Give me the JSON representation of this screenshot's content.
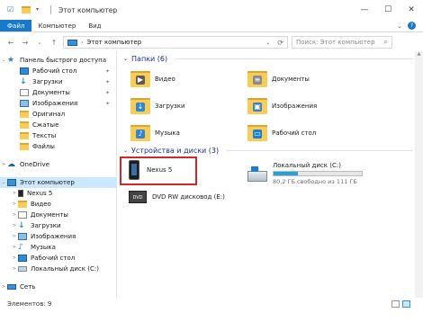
{
  "window": {
    "title": "Этот компьютер",
    "controls": {
      "minimize": "—",
      "maximize": "☐",
      "close": "✕"
    }
  },
  "ribbon": {
    "file_tab": "Файл",
    "tabs": [
      "Компьютер",
      "Вид"
    ],
    "expand": "⌄",
    "help": "?"
  },
  "address": {
    "back": "←",
    "forward": "→",
    "up": "↑",
    "history": "⌄",
    "path": "Этот компьютер",
    "refresh": "⟳",
    "search_placeholder": "Поиск: Этот компьютер",
    "search_icon": "search-icon"
  },
  "navpane": {
    "items": [
      {
        "label": "Панель быстрого доступа",
        "icon": "star-icon",
        "expand": "⌄"
      },
      {
        "label": "Рабочий стол",
        "icon": "desktop-icon",
        "pinned": true
      },
      {
        "label": "Загрузки",
        "icon": "download-icon",
        "pinned": true
      },
      {
        "label": "Документы",
        "icon": "documents-icon",
        "pinned": true
      },
      {
        "label": "Изображения",
        "icon": "pictures-icon",
        "pinned": true
      },
      {
        "label": "Оригинал",
        "icon": "folder-icon"
      },
      {
        "label": "Сжатые",
        "icon": "folder-icon"
      },
      {
        "label": "Тексты",
        "icon": "folder-icon"
      },
      {
        "label": "Файлы",
        "icon": "folder-icon"
      },
      {
        "label": "OneDrive",
        "icon": "onedrive-icon",
        "expand": ">"
      },
      {
        "label": "Этот компьютер",
        "icon": "computer-icon",
        "expand": "⌄",
        "selected": true
      },
      {
        "label": "Nexus 5",
        "icon": "phone-icon",
        "expand": ">"
      },
      {
        "label": "Видео",
        "icon": "video-icon",
        "expand": ">"
      },
      {
        "label": "Документы",
        "icon": "documents-icon",
        "expand": ">"
      },
      {
        "label": "Загрузки",
        "icon": "download-icon",
        "expand": ">"
      },
      {
        "label": "Изображения",
        "icon": "pictures-icon",
        "expand": ">"
      },
      {
        "label": "Музыка",
        "icon": "music-icon",
        "expand": ">"
      },
      {
        "label": "Рабочий стол",
        "icon": "desktop-icon",
        "expand": ">"
      },
      {
        "label": "Локальный диск (C:)",
        "icon": "drive-icon",
        "expand": ">"
      },
      {
        "label": "Сеть",
        "icon": "network-icon",
        "expand": ">"
      }
    ],
    "pin_glyph": "📌"
  },
  "content": {
    "folders_header": "Папки (6)",
    "folders": [
      {
        "label": "Видео",
        "icon": "video-folder-icon",
        "badge": "▶",
        "badge_color": "#5a5a5a"
      },
      {
        "label": "Документы",
        "icon": "documents-folder-icon",
        "badge": "≡",
        "badge_color": "#8a8a8a"
      },
      {
        "label": "Загрузки",
        "icon": "downloads-folder-icon",
        "badge": "↓",
        "badge_color": "#2f86d6"
      },
      {
        "label": "Изображения",
        "icon": "pictures-folder-icon",
        "badge": "▣",
        "badge_color": "#3b7fc0"
      },
      {
        "label": "Музыка",
        "icon": "music-folder-icon",
        "badge": "♪",
        "badge_color": "#2f86d6"
      },
      {
        "label": "Рабочий стол",
        "icon": "desktop-folder-icon",
        "badge": "▭",
        "badge_color": "#1a7ed6"
      }
    ],
    "devices_header": "Устройства и диски (3)",
    "devices": {
      "phone": {
        "label": "Nexus 5"
      },
      "local_disk": {
        "label": "Локальный диск (C:)",
        "free_text": "80,2 ГБ свободно из 111 ГБ",
        "used_fraction": 0.28
      },
      "dvd": {
        "label": "DVD RW дисковод (E:)",
        "badge": "DVD"
      }
    }
  },
  "status": {
    "items_count": "Элементов: 9"
  },
  "colors": {
    "accent": "#1979ca",
    "selection": "#cce8ff",
    "highlight_box": "#d3262b",
    "group_header": "#1e3287"
  }
}
